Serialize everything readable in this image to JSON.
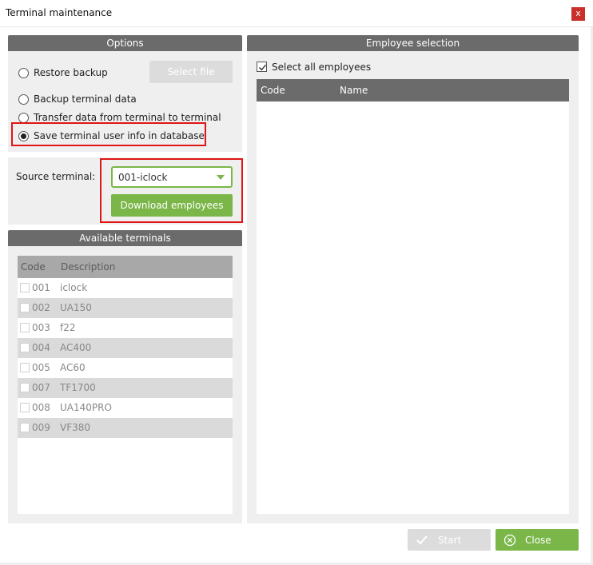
{
  "window": {
    "title": "Terminal maintenance",
    "close_glyph": "x"
  },
  "options": {
    "header": "Options",
    "restore_backup": "Restore backup",
    "select_file": "Select file",
    "backup_terminal_data": "Backup terminal data",
    "transfer_data": "Transfer data from terminal to terminal",
    "save_user_info": "Save terminal user info in database",
    "selected_option": "save_user_info"
  },
  "source": {
    "label": "Source terminal:",
    "selected_terminal": "001-iclock",
    "download_button": "Download employees"
  },
  "available_terminals": {
    "header": "Available terminals",
    "columns": {
      "code": "Code",
      "description": "Description"
    },
    "rows": [
      {
        "code": "001",
        "description": "iclock"
      },
      {
        "code": "002",
        "description": "UA150"
      },
      {
        "code": "003",
        "description": "f22"
      },
      {
        "code": "004",
        "description": "AC400"
      },
      {
        "code": "005",
        "description": "AC60"
      },
      {
        "code": "007",
        "description": "TF1700"
      },
      {
        "code": "008",
        "description": "UA140PRO"
      },
      {
        "code": "009",
        "description": "VF380"
      }
    ]
  },
  "employee_selection": {
    "header": "Employee selection",
    "select_all": "Select all employees",
    "select_all_checked": true,
    "columns": {
      "code": "Code",
      "name": "Name"
    }
  },
  "footer": {
    "start_button": "Start",
    "close_button": "Close"
  },
  "colors": {
    "accent_green": "#7ab648",
    "header_gray": "#6b6b6b",
    "highlight_red": "#e01515"
  }
}
